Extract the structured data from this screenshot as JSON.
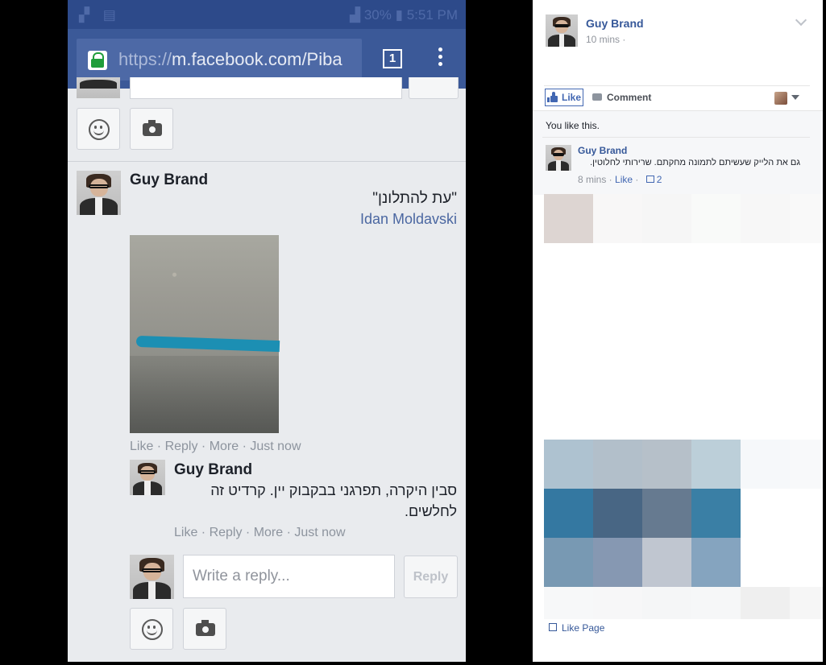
{
  "status_bar": {
    "battery": "30%",
    "time": "5:51 PM"
  },
  "browser": {
    "url_scheme": "https://",
    "url_rest": "m.facebook.com/Piba",
    "tab_count": "1"
  },
  "mobile_post": {
    "author": "Guy Brand",
    "text": "\"עת להתלונן\"",
    "tagged": "Idan Moldavski",
    "actions": "Like · Reply · More · Just now",
    "reply": {
      "author": "Guy Brand",
      "text": "סבין היקרה, תפרגני בבקבוק יין. קרדיט זה לחלשים.",
      "actions": "Like · Reply · More · Just now"
    },
    "write_reply_placeholder": "Write a reply...",
    "reply_button": "Reply"
  },
  "desktop_post": {
    "author": "Guy Brand",
    "time": "10 mins ·",
    "like_button": "Like",
    "comment_button": "Comment",
    "likes_summary": "You like this.",
    "comment": {
      "author": "Guy Brand",
      "text": "גם את הלייק שעשיתם לתמונה מחקתם. שרירותי לחלוטין.",
      "time": "8 mins · ",
      "like_link": "Like",
      "dot": " · ",
      "like_count": "2"
    },
    "like_page": "Like Page"
  }
}
